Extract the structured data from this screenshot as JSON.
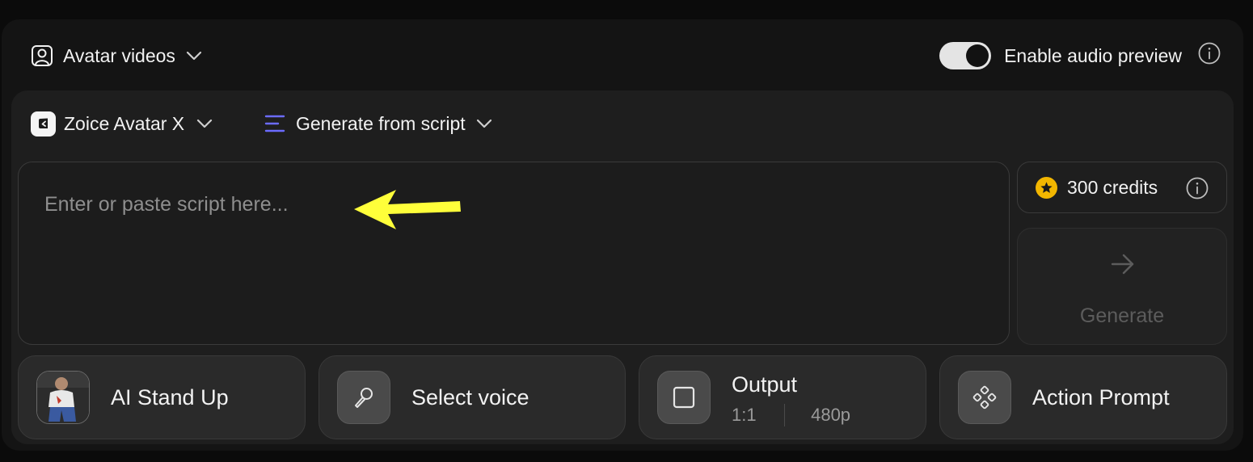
{
  "header": {
    "mode_label": "Avatar videos",
    "audio_preview_label": "Enable audio preview",
    "audio_preview_enabled": true
  },
  "toolbar": {
    "model_label": "Zoice Avatar X",
    "generation_mode_label": "Generate from script"
  },
  "script": {
    "placeholder": "Enter or paste script here...",
    "value": ""
  },
  "credits": {
    "amount": "300",
    "unit": "credits"
  },
  "generate": {
    "label": "Generate",
    "enabled": false
  },
  "chips": {
    "avatar": {
      "label": "AI Stand Up"
    },
    "voice": {
      "label": "Select voice"
    },
    "output": {
      "label": "Output",
      "aspect_ratio": "1:1",
      "resolution": "480p"
    },
    "action": {
      "label": "Action Prompt"
    }
  },
  "icons": {
    "mode": "user-square-icon",
    "model": "app-logo-icon",
    "generation_mode": "lines-icon",
    "info": "info-icon",
    "credits": "star-coin-icon",
    "generate": "arrow-right-icon",
    "voice": "microphone-icon",
    "output": "square-icon",
    "action": "diamond-dots-icon",
    "annotation": "yellow-arrow-icon"
  },
  "colors": {
    "accent_lines": "#6b6bff",
    "coin": "#f2b600",
    "annotation_arrow": "#ffff3a"
  }
}
